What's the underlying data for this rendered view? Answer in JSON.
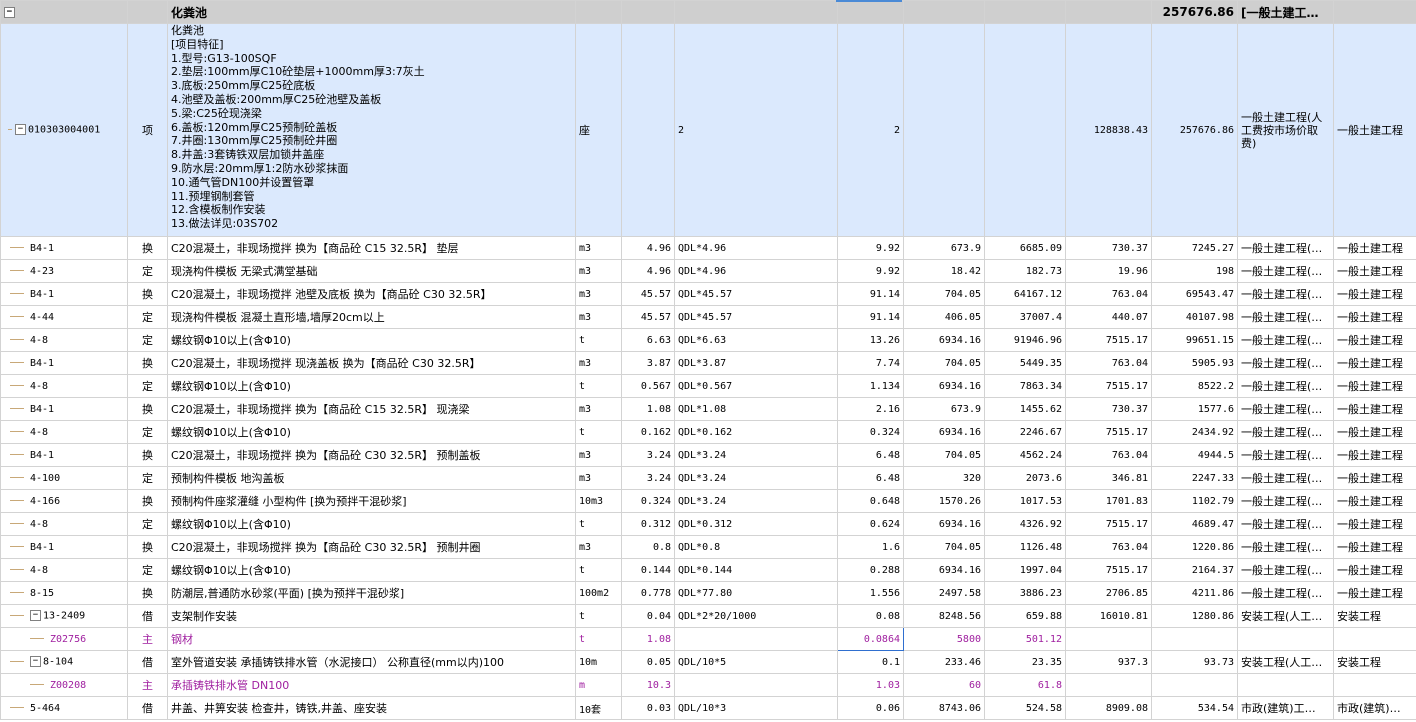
{
  "header": {
    "name": "化粪池",
    "total": "257676.86",
    "fee_type": "[一般土建工…"
  },
  "main": {
    "code": "010303004001",
    "type": "项",
    "name_lines": [
      "化粪池",
      "[项目特征]",
      "1.型号:G13-100SQF",
      "2.垫层:100mm厚C10砼垫层+1000mm厚3:7灰土",
      "3.底板:250mm厚C25砼底板",
      "4.池壁及盖板:200mm厚C25砼池壁及盖板",
      "5.梁:C25砼现浇梁",
      "6.盖板:120mm厚C25预制砼盖板",
      "7.井圈:130mm厚C25预制砼井圈",
      "8.井盖:3套铸铁双层加锁井盖座",
      "9.防水层:20mm厚1:2防水砂浆抹面",
      "10.通气管DN100并设置管罩",
      "11.预埋钢制套管",
      "12.含模板制作安装",
      "13.做法详见:03S702"
    ],
    "unit": "座",
    "expr": "2",
    "qty": "2",
    "price": "128838.43",
    "total": "257676.86",
    "fee": "一般土建工程(人工费按市场价取费)",
    "major": "一般土建工程"
  },
  "rows": [
    {
      "code": "B4-1",
      "type": "换",
      "name": "C20混凝土，非现场搅拌  换为【商品砼 C15 32.5R】 垫层",
      "unit": "m3",
      "content": "4.96",
      "expr": "QDL*4.96",
      "qty": "9.92",
      "price": "673.9",
      "amount": "6685.09",
      "uprice": "730.37",
      "total": "7245.27",
      "fee": "一般土建工程(…",
      "major": "一般土建工程"
    },
    {
      "code": "4-23",
      "type": "定",
      "name": "现浇构件模板 无梁式满堂基础",
      "unit": "m3",
      "content": "4.96",
      "expr": "QDL*4.96",
      "qty": "9.92",
      "price": "18.42",
      "amount": "182.73",
      "uprice": "19.96",
      "total": "198",
      "fee": "一般土建工程(…",
      "major": "一般土建工程"
    },
    {
      "code": "B4-1",
      "type": "换",
      "name": "C20混凝土，非现场搅拌  池壁及底板  换为【商品砼 C30 32.5R】",
      "unit": "m3",
      "content": "45.57",
      "expr": "QDL*45.57",
      "qty": "91.14",
      "price": "704.05",
      "amount": "64167.12",
      "uprice": "763.04",
      "total": "69543.47",
      "fee": "一般土建工程(…",
      "major": "一般土建工程"
    },
    {
      "code": "4-44",
      "type": "定",
      "name": "现浇构件模板 混凝土直形墙,墙厚20cm以上",
      "unit": "m3",
      "content": "45.57",
      "expr": "QDL*45.57",
      "qty": "91.14",
      "price": "406.05",
      "amount": "37007.4",
      "uprice": "440.07",
      "total": "40107.98",
      "fee": "一般土建工程(…",
      "major": "一般土建工程"
    },
    {
      "code": "4-8",
      "type": "定",
      "name": "螺纹钢Φ10以上(含Φ10)",
      "unit": "t",
      "content": "6.63",
      "expr": "QDL*6.63",
      "qty": "13.26",
      "price": "6934.16",
      "amount": "91946.96",
      "uprice": "7515.17",
      "total": "99651.15",
      "fee": "一般土建工程(…",
      "major": "一般土建工程"
    },
    {
      "code": "B4-1",
      "type": "换",
      "name": "C20混凝土，非现场搅拌  现浇盖板  换为【商品砼 C30 32.5R】",
      "unit": "m3",
      "content": "3.87",
      "expr": "QDL*3.87",
      "qty": "7.74",
      "price": "704.05",
      "amount": "5449.35",
      "uprice": "763.04",
      "total": "5905.93",
      "fee": "一般土建工程(…",
      "major": "一般土建工程"
    },
    {
      "code": "4-8",
      "type": "定",
      "name": "螺纹钢Φ10以上(含Φ10)",
      "unit": "t",
      "content": "0.567",
      "expr": "QDL*0.567",
      "qty": "1.134",
      "price": "6934.16",
      "amount": "7863.34",
      "uprice": "7515.17",
      "total": "8522.2",
      "fee": "一般土建工程(…",
      "major": "一般土建工程"
    },
    {
      "code": "B4-1",
      "type": "换",
      "name": "C20混凝土，非现场搅拌  换为【商品砼 C15 32.5R】 现浇梁",
      "unit": "m3",
      "content": "1.08",
      "expr": "QDL*1.08",
      "qty": "2.16",
      "price": "673.9",
      "amount": "1455.62",
      "uprice": "730.37",
      "total": "1577.6",
      "fee": "一般土建工程(…",
      "major": "一般土建工程"
    },
    {
      "code": "4-8",
      "type": "定",
      "name": "螺纹钢Φ10以上(含Φ10)",
      "unit": "t",
      "content": "0.162",
      "expr": "QDL*0.162",
      "qty": "0.324",
      "price": "6934.16",
      "amount": "2246.67",
      "uprice": "7515.17",
      "total": "2434.92",
      "fee": "一般土建工程(…",
      "major": "一般土建工程"
    },
    {
      "code": "B4-1",
      "type": "换",
      "name": "C20混凝土，非现场搅拌  换为【商品砼 C30 32.5R】 预制盖板",
      "unit": "m3",
      "content": "3.24",
      "expr": "QDL*3.24",
      "qty": "6.48",
      "price": "704.05",
      "amount": "4562.24",
      "uprice": "763.04",
      "total": "4944.5",
      "fee": "一般土建工程(…",
      "major": "一般土建工程"
    },
    {
      "code": "4-100",
      "type": "定",
      "name": "预制构件模板 地沟盖板",
      "unit": "m3",
      "content": "3.24",
      "expr": "QDL*3.24",
      "qty": "6.48",
      "price": "320",
      "amount": "2073.6",
      "uprice": "346.81",
      "total": "2247.33",
      "fee": "一般土建工程(…",
      "major": "一般土建工程"
    },
    {
      "code": "4-166",
      "type": "换",
      "name": "预制构件座浆灌缝 小型构件  [换为预拌干混砂浆]",
      "unit": "10m3",
      "content": "0.324",
      "expr": "QDL*3.24",
      "qty": "0.648",
      "price": "1570.26",
      "amount": "1017.53",
      "uprice": "1701.83",
      "total": "1102.79",
      "fee": "一般土建工程(…",
      "major": "一般土建工程"
    },
    {
      "code": "4-8",
      "type": "定",
      "name": "螺纹钢Φ10以上(含Φ10)",
      "unit": "t",
      "content": "0.312",
      "expr": "QDL*0.312",
      "qty": "0.624",
      "price": "6934.16",
      "amount": "4326.92",
      "uprice": "7515.17",
      "total": "4689.47",
      "fee": "一般土建工程(…",
      "major": "一般土建工程"
    },
    {
      "code": "B4-1",
      "type": "换",
      "name": "C20混凝土，非现场搅拌  换为【商品砼 C30 32.5R】 预制井圈",
      "unit": "m3",
      "content": "0.8",
      "expr": "QDL*0.8",
      "qty": "1.6",
      "price": "704.05",
      "amount": "1126.48",
      "uprice": "763.04",
      "total": "1220.86",
      "fee": "一般土建工程(…",
      "major": "一般土建工程"
    },
    {
      "code": "4-8",
      "type": "定",
      "name": "螺纹钢Φ10以上(含Φ10)",
      "unit": "t",
      "content": "0.144",
      "expr": "QDL*0.144",
      "qty": "0.288",
      "price": "6934.16",
      "amount": "1997.04",
      "uprice": "7515.17",
      "total": "2164.37",
      "fee": "一般土建工程(…",
      "major": "一般土建工程"
    },
    {
      "code": "8-15",
      "type": "换",
      "name": "防潮层,普通防水砂浆(平面)  [换为预拌干混砂浆]",
      "unit": "100m2",
      "content": "0.778",
      "expr": "QDL*77.80",
      "qty": "1.556",
      "price": "2497.58",
      "amount": "3886.23",
      "uprice": "2706.85",
      "total": "4211.86",
      "fee": "一般土建工程(…",
      "major": "一般土建工程"
    }
  ],
  "group1": {
    "code": "13-2409",
    "type": "借",
    "name": "支架制作安装",
    "unit": "t",
    "content": "0.04",
    "expr": "QDL*2*20/1000",
    "qty": "0.08",
    "price": "8248.56",
    "amount": "659.88",
    "uprice": "16010.81",
    "total": "1280.86",
    "fee": "安装工程(人工…",
    "major": "安装工程"
  },
  "sub1": {
    "code": "Z02756",
    "type": "主",
    "name": "钢材",
    "unit": "t",
    "content": "1.08",
    "qty": "0.0864",
    "price": "5800",
    "amount": "501.12"
  },
  "group2": {
    "code": "8-104",
    "type": "借",
    "name": "室外管道安装 承插铸铁排水管（水泥接口） 公称直径(mm以内)100",
    "unit": "10m",
    "content": "0.05",
    "expr": "QDL/10*5",
    "qty": "0.1",
    "price": "233.46",
    "amount": "23.35",
    "uprice": "937.3",
    "total": "93.73",
    "fee": "安装工程(人工…",
    "major": "安装工程"
  },
  "sub2": {
    "code": "Z00208",
    "type": "主",
    "name": "承插铸铁排水管 DN100",
    "unit": "m",
    "content": "10.3",
    "qty": "1.03",
    "price": "60",
    "amount": "61.8"
  },
  "last": {
    "code": "5-464",
    "type": "借",
    "name": "井盖、井箅安装 检查井，铸铁,井盖、座安装",
    "unit": "10套",
    "content": "0.03",
    "expr": "QDL/10*3",
    "qty": "0.06",
    "price": "8743.06",
    "amount": "524.58",
    "uprice": "8909.08",
    "total": "534.54",
    "fee": "市政(建筑)工…",
    "major": "市政(建筑)…"
  },
  "icons": {
    "collapse": "minus-box-icon"
  },
  "colors": {
    "header_bg": "#cfcfcf",
    "selected_row_bg": "#dbe9fd",
    "sub_text": "#a020a0",
    "selection_border": "#2f6fcf"
  }
}
